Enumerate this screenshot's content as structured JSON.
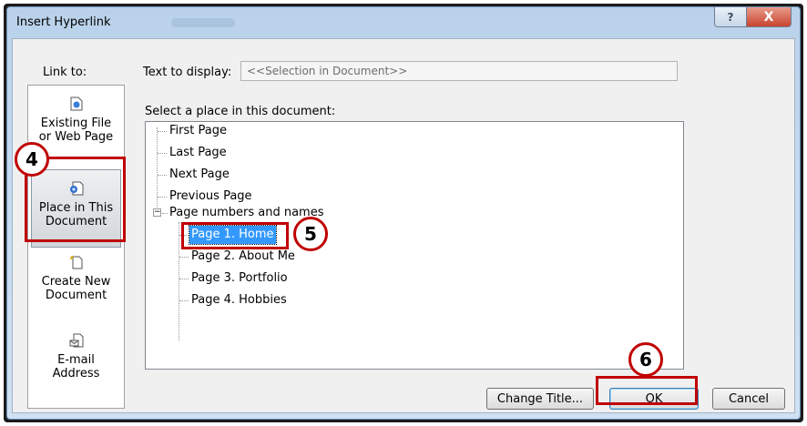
{
  "window": {
    "title": "Insert Hyperlink",
    "help_symbol": "?",
    "close_symbol": "X"
  },
  "link_to": {
    "label_pre": "Link to:",
    "places": [
      {
        "id": "existing",
        "line1": "Existing File",
        "line2": "or Web Page",
        "icon": "web-page-icon"
      },
      {
        "id": "this_document",
        "line1": "Place in This",
        "line2": "Document",
        "icon": "place-in-document-icon"
      },
      {
        "id": "new_document",
        "line1": "Create New",
        "line2": "Document",
        "icon": "new-document-icon"
      },
      {
        "id": "email",
        "line1": "E-mail",
        "line2": "Address",
        "icon": "email-icon"
      }
    ]
  },
  "text_to_display": {
    "label": "Text to display:",
    "value": "<<Selection in Document>>"
  },
  "tree": {
    "label": "Select a place in this document:",
    "top_items": [
      "First Page",
      "Last Page",
      "Next Page",
      "Previous Page"
    ],
    "group": "Page numbers and names",
    "group_expander": "−",
    "children": [
      "Page 1. Home",
      "Page 2. About Me",
      "Page 3. Portfolio",
      "Page 4. Hobbies"
    ],
    "selected": "Page 1. Home"
  },
  "buttons": {
    "change_title": "Change Title...",
    "ok": "OK",
    "cancel": "Cancel"
  },
  "callouts": [
    "4",
    "5",
    "6"
  ],
  "colors": {
    "callout": "#c00000",
    "selection": "#3399ff"
  }
}
